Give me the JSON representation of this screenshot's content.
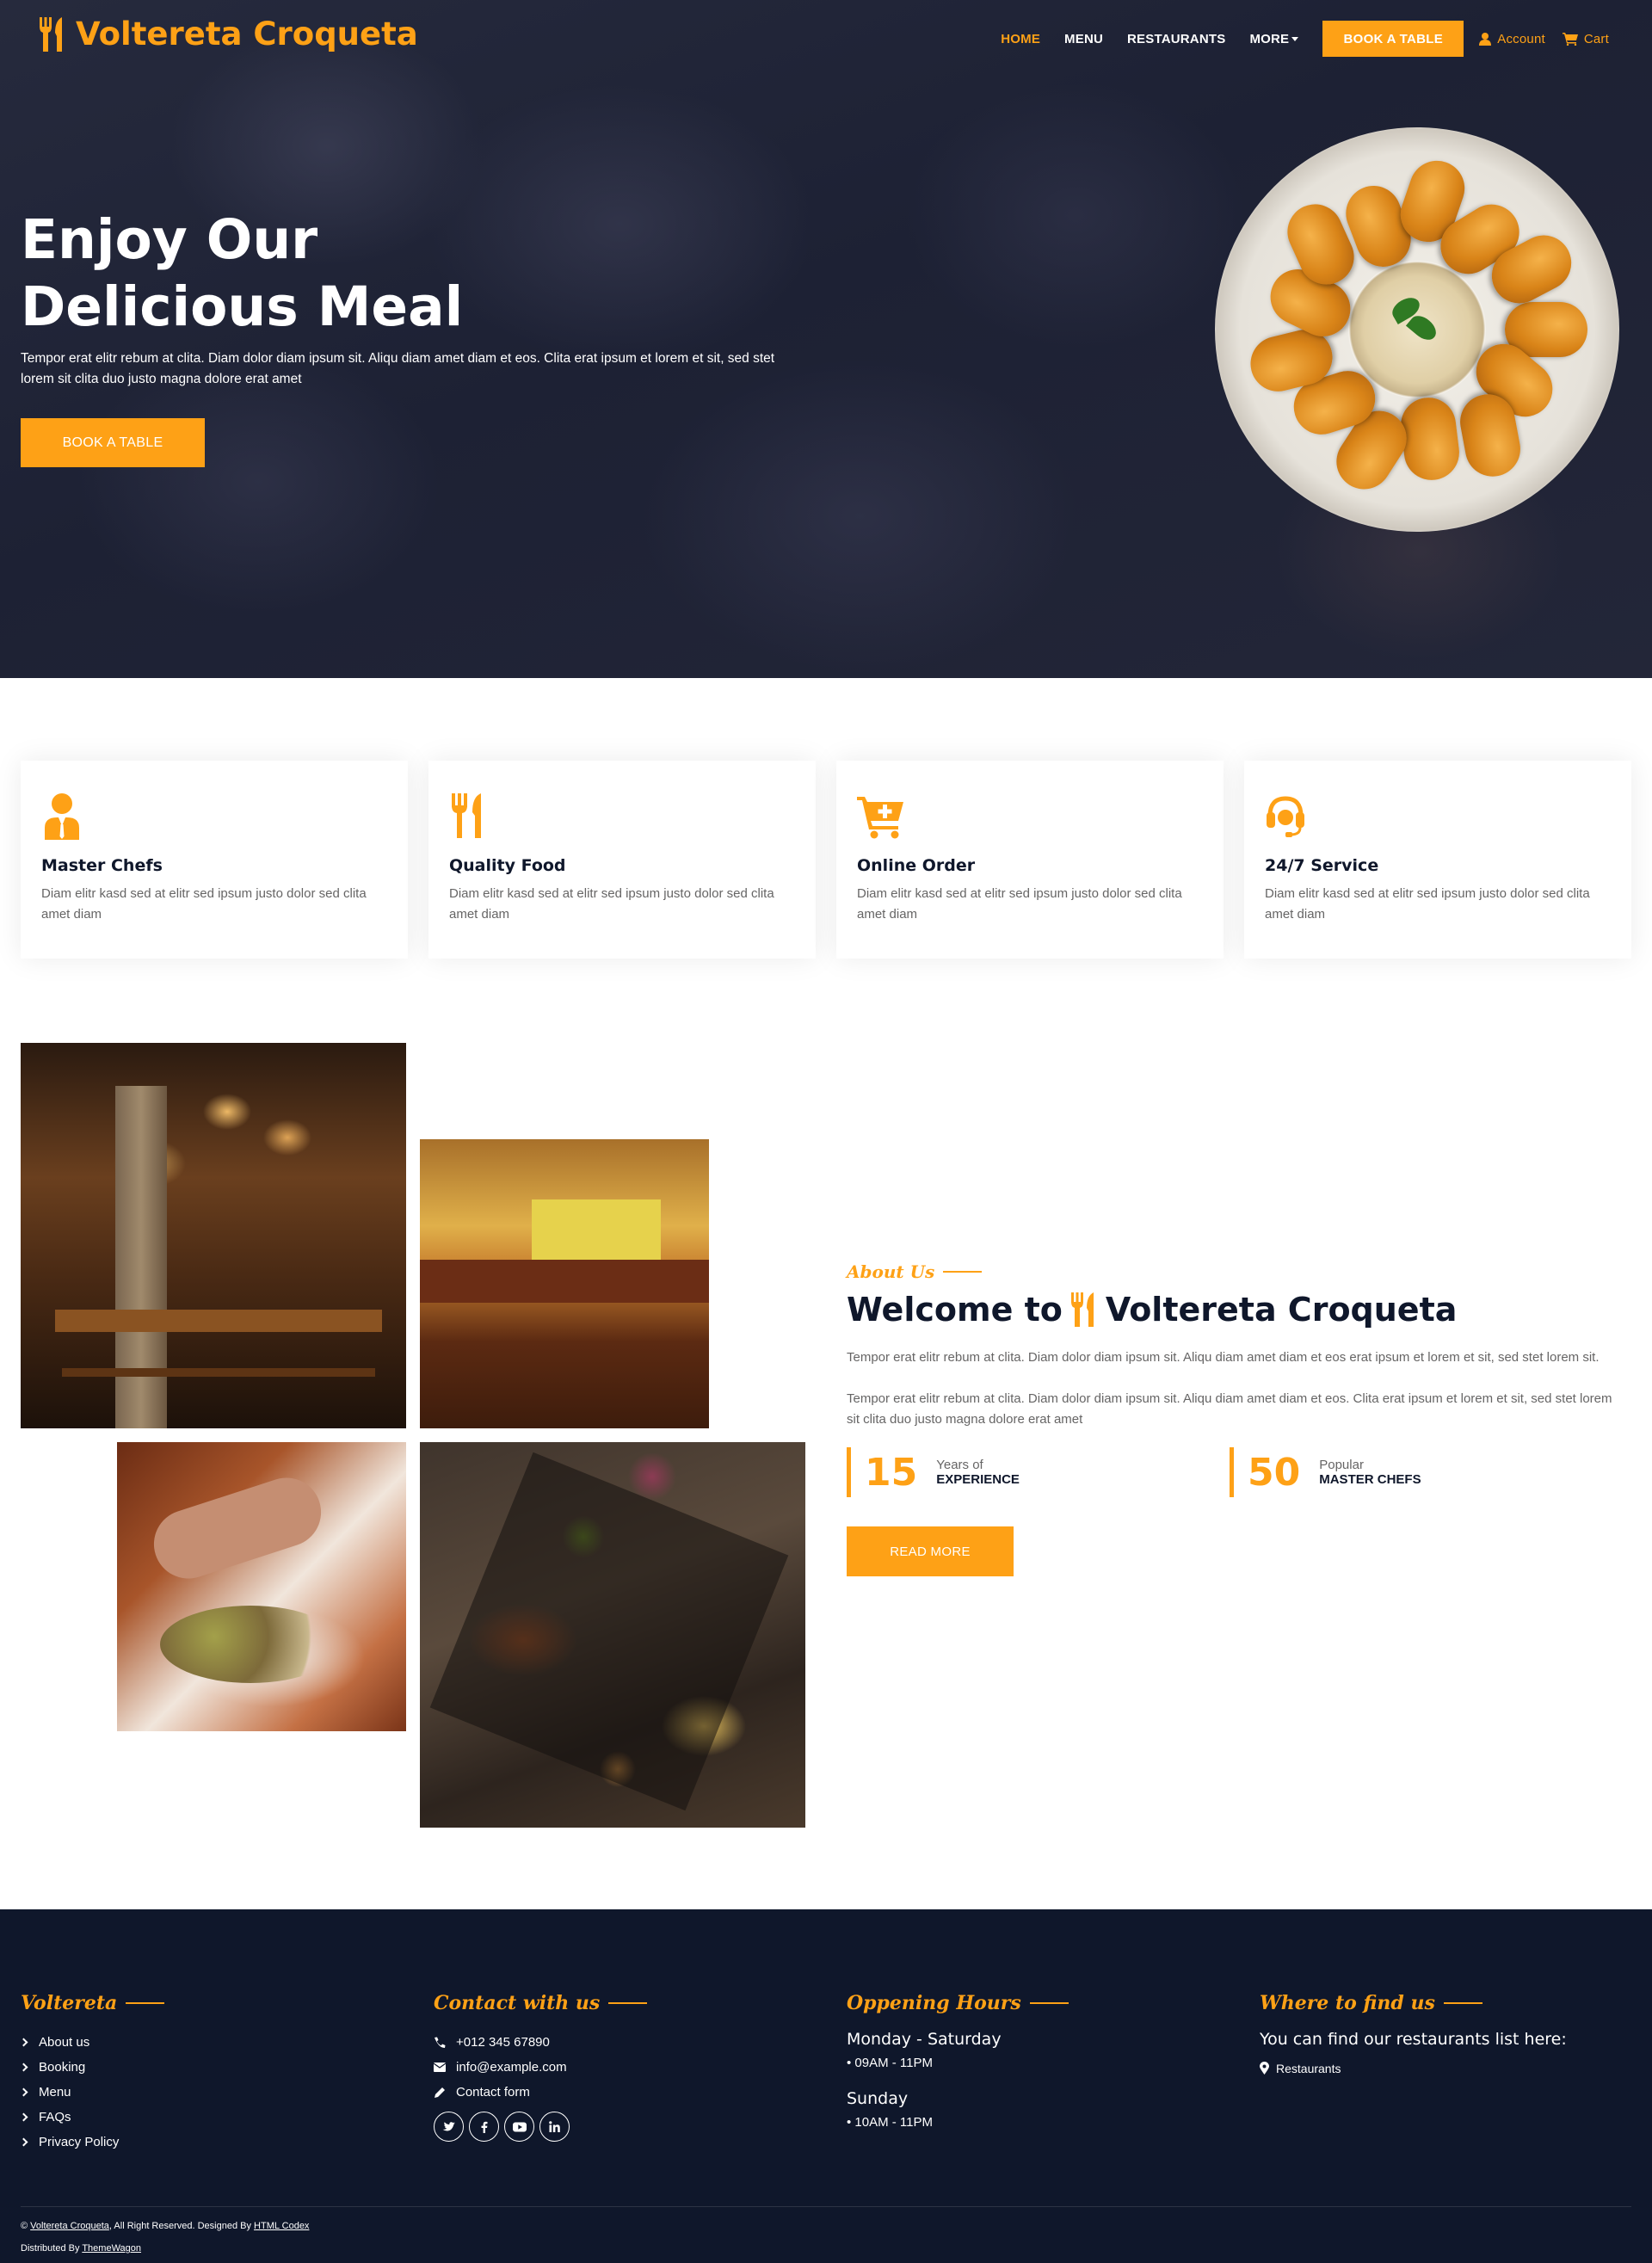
{
  "nav": {
    "brand": "Voltereta Croqueta",
    "links": [
      "HOME",
      "MENU",
      "RESTAURANTS",
      "MORE"
    ],
    "book_button": "BOOK A TABLE",
    "account": "Account",
    "cart": "Cart"
  },
  "hero": {
    "title_line1": "Enjoy Our",
    "title_line2": "Delicious Meal",
    "text": "Tempor erat elitr rebum at clita. Diam dolor diam ipsum sit. Aliqu diam amet diam et eos. Clita erat ipsum et lorem et sit, sed stet lorem sit clita duo justo magna dolore erat amet",
    "button": "BOOK A TABLE"
  },
  "services": [
    {
      "icon": "chef-icon",
      "title": "Master Chefs",
      "text": "Diam elitr kasd sed at elitr sed ipsum justo dolor sed clita amet diam"
    },
    {
      "icon": "utensils-icon",
      "title": "Quality Food",
      "text": "Diam elitr kasd sed at elitr sed ipsum justo dolor sed clita amet diam"
    },
    {
      "icon": "cart-plus-icon",
      "title": "Online Order",
      "text": "Diam elitr kasd sed at elitr sed ipsum justo dolor sed clita amet diam"
    },
    {
      "icon": "headset-icon",
      "title": "24/7 Service",
      "text": "Diam elitr kasd sed at elitr sed ipsum justo dolor sed clita amet diam"
    }
  ],
  "about": {
    "tag": "About Us",
    "heading_prefix": "Welcome to",
    "heading_brand": "Voltereta Croqueta",
    "para1": "Tempor erat elitr rebum at clita. Diam dolor diam ipsum sit. Aliqu diam amet diam et eos erat ipsum et lorem et sit, sed stet lorem sit.",
    "para2": "Tempor erat elitr rebum at clita. Diam dolor diam ipsum sit. Aliqu diam amet diam et eos. Clita erat ipsum et lorem et sit, sed stet lorem sit clita duo justo magna dolore erat amet",
    "stats": [
      {
        "number": "15",
        "top": "Years of",
        "bottom": "EXPERIENCE"
      },
      {
        "number": "50",
        "top": "Popular",
        "bottom": "MASTER CHEFS"
      }
    ],
    "button": "READ MORE"
  },
  "footer": {
    "col1": {
      "title": "Voltereta",
      "links": [
        "About us",
        "Booking",
        "Menu",
        "FAQs",
        "Privacy Policy"
      ]
    },
    "col2": {
      "title": "Contact with us",
      "phone": "+012 345 67890",
      "email": "info@example.com",
      "form": "Contact form"
    },
    "col3": {
      "title": "Oppening Hours",
      "day1": "Monday - Saturday",
      "hours1": "• 09AM - 11PM",
      "day2": "Sunday",
      "hours2": "• 10AM - 11PM"
    },
    "col4": {
      "title": "Where to find us",
      "text": "You can find our restaurants list here:",
      "link": "Restaurants"
    },
    "copyright_brand": "Voltereta Croqueta",
    "copyright_mid": ", All Right Reserved. Designed By ",
    "designer": "HTML Codex",
    "distributed_prefix": "Distributed By ",
    "distributor": "ThemeWagon"
  },
  "colors": {
    "accent": "#fea116",
    "dark": "#0f172b",
    "text": "#666565"
  }
}
